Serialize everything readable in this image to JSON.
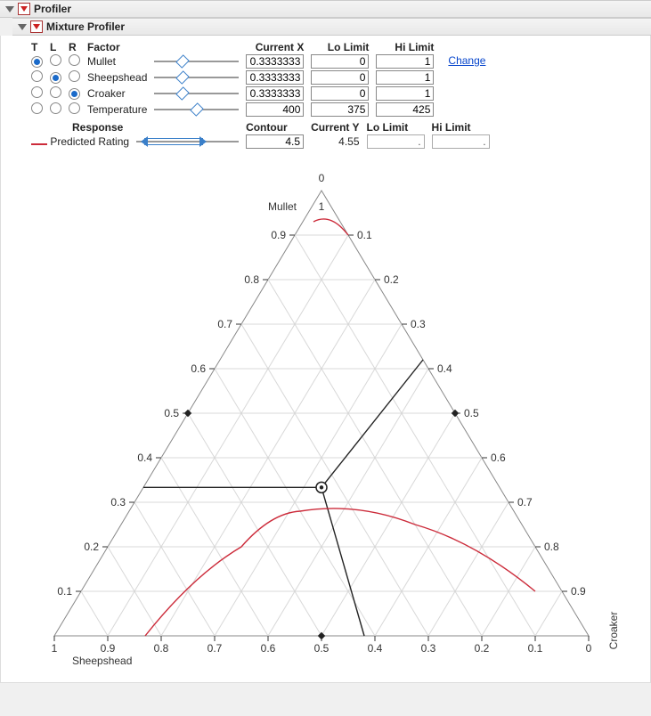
{
  "profiler": {
    "title": "Profiler"
  },
  "mixture": {
    "title": "Mixture Profiler"
  },
  "columns": {
    "T": "T",
    "L": "L",
    "R": "R",
    "Factor": "Factor",
    "CurrentX": "Current X",
    "LoLimit": "Lo Limit",
    "HiLimit": "Hi Limit",
    "Change": "Change",
    "Response": "Response",
    "Contour": "Contour",
    "CurrentY": "Current Y"
  },
  "factors": [
    {
      "name": "Mullet",
      "sel": "T",
      "slider": 0.333,
      "currentX": "0.3333333",
      "lo": "0",
      "hi": "1"
    },
    {
      "name": "Sheepshead",
      "sel": "L",
      "slider": 0.333,
      "currentX": "0.3333333",
      "lo": "0",
      "hi": "1"
    },
    {
      "name": "Croaker",
      "sel": "R",
      "slider": 0.333,
      "currentX": "0.3333333",
      "lo": "0",
      "hi": "1"
    },
    {
      "name": "Temperature",
      "sel": "",
      "slider": 0.5,
      "currentX": "400",
      "lo": "375",
      "hi": "425"
    }
  ],
  "response": {
    "name": "Predicted Rating",
    "contour": "4.5",
    "currentY": "4.55",
    "lo": ".",
    "hi": "."
  },
  "ternary": {
    "topLabel": "Mullet",
    "leftLabel": "Sheepshead",
    "rightLabel": "Croaker",
    "apexTop": "0",
    "apexSub": "1",
    "ticks": [
      "0.1",
      "0.2",
      "0.3",
      "0.4",
      "0.5",
      "0.6",
      "0.7",
      "0.8",
      "0.9"
    ],
    "bottomTicks": [
      "1",
      "0.9",
      "0.8",
      "0.7",
      "0.6",
      "0.5",
      "0.4",
      "0.3",
      "0.2",
      "0.1",
      "0"
    ]
  },
  "chart_data": {
    "type": "ternary-contour",
    "title": "Mixture Profiler",
    "axes": {
      "top": "Mullet",
      "left": "Sheepshead",
      "right": "Croaker"
    },
    "current_point": {
      "Mullet": 0.3333333,
      "Sheepshead": 0.3333333,
      "Croaker": 0.3333333
    },
    "other_factors": {
      "Temperature": 400,
      "Temperature_range": [
        375,
        425
      ]
    },
    "response": {
      "name": "Predicted Rating",
      "contour_level": 4.5,
      "current_value": 4.55
    },
    "axis_range": [
      0,
      1
    ],
    "tick_step": 0.1,
    "contours": [
      {
        "level": 4.5,
        "approx_path": [
          {
            "Sheepshead": 0.83,
            "Croaker": 0.17,
            "Mullet": 0.0
          },
          {
            "Sheepshead": 0.55,
            "Croaker": 0.25,
            "Mullet": 0.2
          },
          {
            "Sheepshead": 0.4,
            "Croaker": 0.32,
            "Mullet": 0.28
          },
          {
            "Sheepshead": 0.2,
            "Croaker": 0.55,
            "Mullet": 0.25
          },
          {
            "Sheepshead": 0.05,
            "Croaker": 0.85,
            "Mullet": 0.1
          }
        ]
      },
      {
        "level": 4.5,
        "approx_path": [
          {
            "Sheepshead": 0.05,
            "Croaker": 0.02,
            "Mullet": 0.93
          },
          {
            "Sheepshead": 0.0,
            "Croaker": 0.1,
            "Mullet": 0.9
          }
        ]
      }
    ]
  }
}
